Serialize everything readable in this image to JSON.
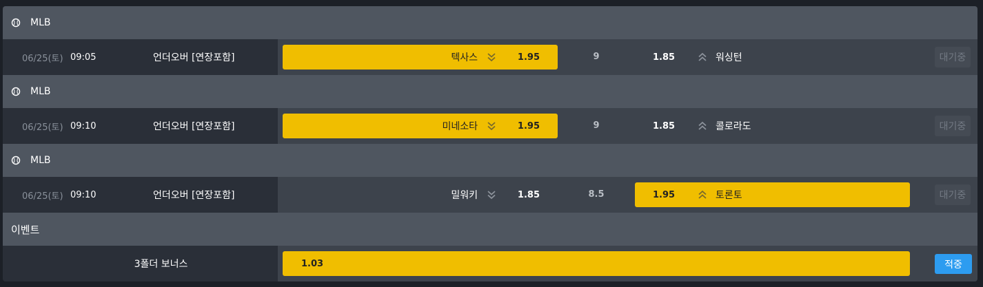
{
  "colors": {
    "accent": "#f0be00",
    "button": "#2d9cf0",
    "header_bg": "#4f5660",
    "row_bg": "#3d434c"
  },
  "games": [
    {
      "league": "MLB",
      "league_icon": "baseball-icon",
      "date": "06/25(토)",
      "time": "09:05",
      "market": "언더오버 [연장포함]",
      "home": {
        "name": "텍사스",
        "odds": "1.95",
        "arrow": "chevron-double-down-icon",
        "selected": true
      },
      "line": "9",
      "away": {
        "name": "워싱턴",
        "odds": "1.85",
        "arrow": "chevron-double-up-icon",
        "selected": false
      },
      "status": "대기중"
    },
    {
      "league": "MLB",
      "league_icon": "baseball-icon",
      "date": "06/25(토)",
      "time": "09:10",
      "market": "언더오버 [연장포함]",
      "home": {
        "name": "미네소타",
        "odds": "1.95",
        "arrow": "chevron-double-down-icon",
        "selected": true
      },
      "line": "9",
      "away": {
        "name": "콜로라도",
        "odds": "1.85",
        "arrow": "chevron-double-up-icon",
        "selected": false
      },
      "status": "대기중"
    },
    {
      "league": "MLB",
      "league_icon": "baseball-icon",
      "date": "06/25(토)",
      "time": "09:10",
      "market": "언더오버 [연장포함]",
      "home": {
        "name": "밀워키",
        "odds": "1.85",
        "arrow": "chevron-double-down-icon",
        "selected": false
      },
      "line": "8.5",
      "away": {
        "name": "토론토",
        "odds": "1.95",
        "arrow": "chevron-double-up-icon",
        "selected": true
      },
      "status": "대기중"
    }
  ],
  "event": {
    "header": "이벤트",
    "name": "3폴더 보너스",
    "odds": "1.03",
    "button": "적중"
  }
}
